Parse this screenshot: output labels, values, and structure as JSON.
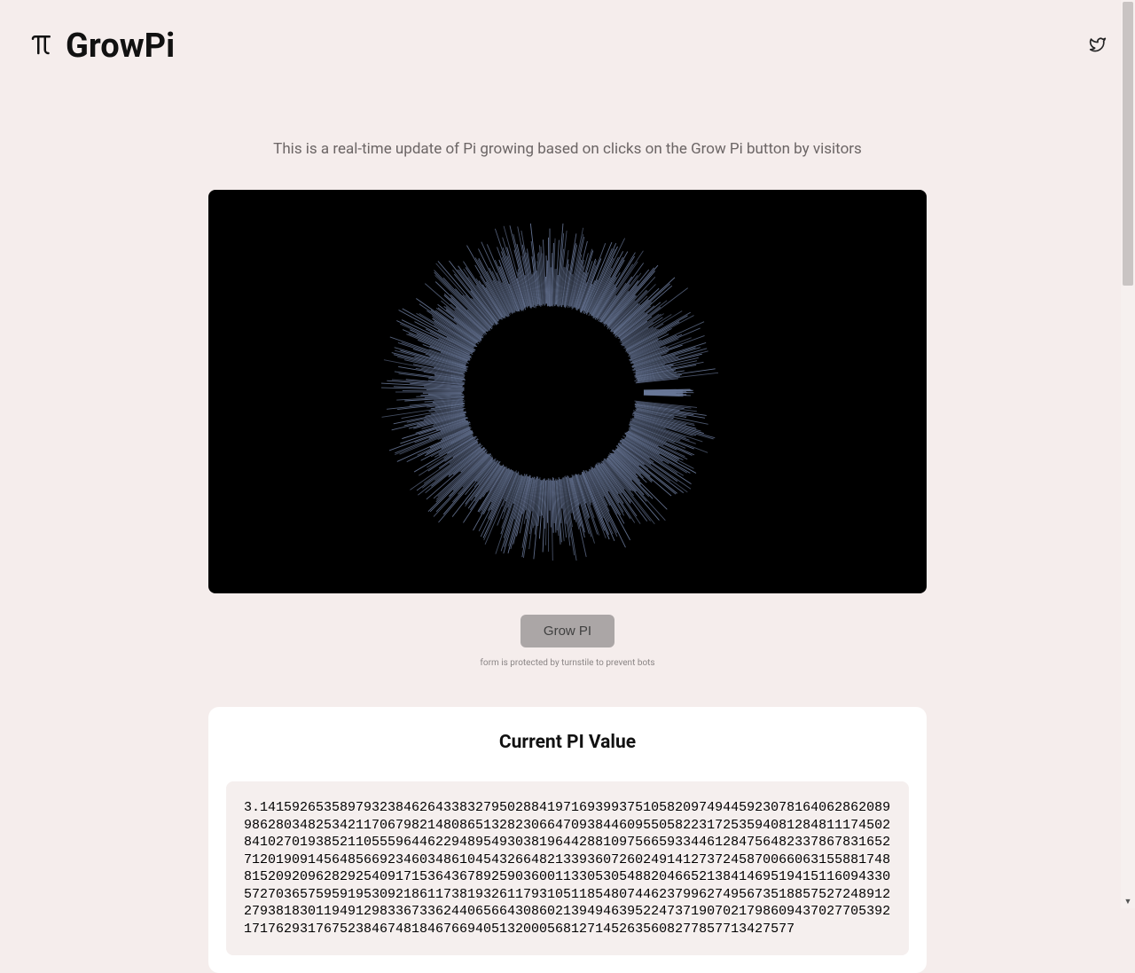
{
  "brand": {
    "name": "GrowPi"
  },
  "description": "This is a real-time update of Pi growing based on clicks on the Grow Pi button by visitors",
  "button": {
    "grow_label": "Grow PI"
  },
  "turnstile_note": "form is protected by turnstile to prevent bots",
  "pi_card": {
    "title": "Current PI Value",
    "value": "3.1415926535897932384626433832795028841971693993751058209749445923078164062862089986280348253421170679821480865132823066470938446095505822317253594081284811174502841027019385211055596446229489549303819644288109756659334461284756482337867831652712019091456485669234603486104543266482133936072602491412737245870066063155881748815209209628292540917153643678925903600113305305488204665213841469519415116094330572703657595919530921861173819326117931051185480744623799627495673518857527248912279381830119491298336733624406566430860213949463952247371907021798609437027705392171762931767523846748184676694051320005681271452635608277857713427577"
  },
  "viz": {
    "spike_color": "#6b7a9b",
    "bg_color": "#000000"
  }
}
